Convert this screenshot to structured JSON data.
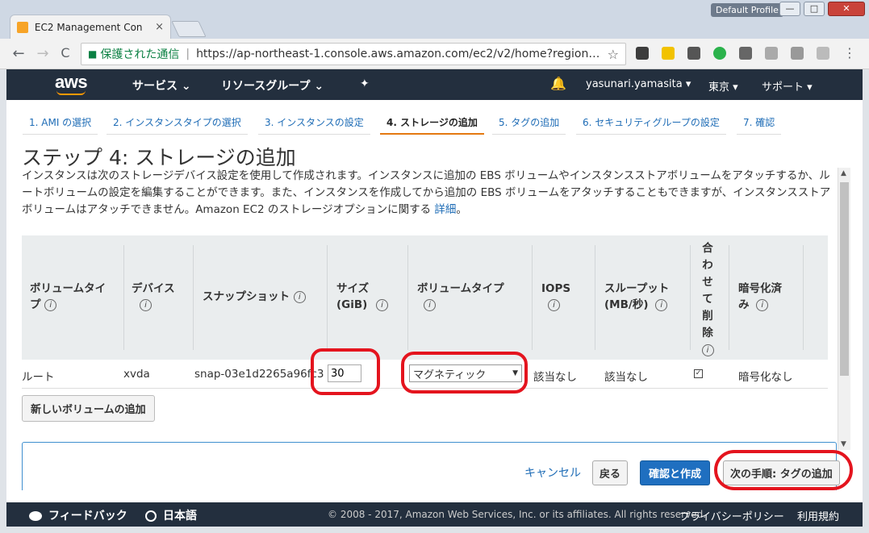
{
  "browser": {
    "tab_title": "EC2 Management Con",
    "tab_close": "×",
    "profile": "Default Profile",
    "win_min": "—",
    "win_max": "□",
    "win_close": "✕",
    "back": "←",
    "forward": "→",
    "reload": "C",
    "secure_text": "保護された通信",
    "separator": "|",
    "url": "https://ap-northeast-1.console.aws.amazon.com/ec2/v2/home?region…",
    "star": "☆",
    "menu": "⋮"
  },
  "aws_header": {
    "logo": "aws",
    "services": "サービス ⌄",
    "resource_groups": "リソースグループ ⌄",
    "pin": "✦",
    "bell": "🔔",
    "user": "yasunari.yamasita ▾",
    "region": "東京 ▾",
    "support": "サポート ▾"
  },
  "steps": [
    "1. AMI の選択",
    "2. インスタンスタイプの選択",
    "3. インスタンスの設定",
    "4. ストレージの追加",
    "5. タグの追加",
    "6. セキュリティグループの設定",
    "7. 確認"
  ],
  "page": {
    "title": "ステップ 4: ストレージの追加",
    "description": "インスタンスは次のストレージデバイス設定を使用して作成されます。インスタンスに追加の EBS ボリュームやインスタンスストアボリュームをアタッチするか、ルートボリュームの設定を編集することができます。また、インスタンスを作成してから追加の EBS ボリュームをアタッチすることもできますが、インスタンスストアボリュームはアタッチできません。Amazon EC2 のストレージオプションに関する",
    "details_link": "詳細",
    "period": "。"
  },
  "table": {
    "headers": {
      "volume_type_1": "ボリュームタイ",
      "volume_type_2": "プ",
      "device": "デバイス",
      "snapshot": "スナップショット",
      "size_1": "サイズ",
      "size_2": "(GiB)",
      "volume_type_col": "ボリュームタイプ",
      "iops": "IOPS",
      "throughput_1": "スループット",
      "throughput_2": "(MB/秒)",
      "delete_1": "合",
      "delete_2": "わ",
      "delete_3": "せ",
      "delete_4": "て",
      "delete_5": "削",
      "delete_6": "除",
      "encrypted_1": "暗号化済",
      "encrypted_2": "み"
    },
    "info_icon": "i",
    "row": {
      "volume_type": "ルート",
      "device": "xvda",
      "snapshot": "snap-03e1d2265a96fc3c",
      "size": "30",
      "volume_select": "マグネティック",
      "caret": "▼",
      "iops": "該当なし",
      "throughput": "該当なし",
      "delete_check": "✓",
      "encrypted": "暗号化なし"
    }
  },
  "buttons": {
    "add_volume": "新しいボリュームの追加",
    "cancel": "キャンセル",
    "back": "戻る",
    "review": "確認と作成",
    "next": "次の手順: タグの追加"
  },
  "scroll": {
    "up": "▲",
    "down": "▼"
  },
  "footer": {
    "feedback": "フィードバック",
    "language": "日本語",
    "copyright": "© 2008 - 2017, Amazon Web Services, Inc. or its affiliates. All rights reserved.",
    "privacy": "プライバシーポリシー",
    "terms": "利用規約"
  },
  "colors": {
    "aws_nav": "#232f3e",
    "accent_orange": "#e47911",
    "link_blue": "#1e6cb6",
    "primary_button": "#1f6fc0",
    "annotation_red": "#e4141e"
  }
}
